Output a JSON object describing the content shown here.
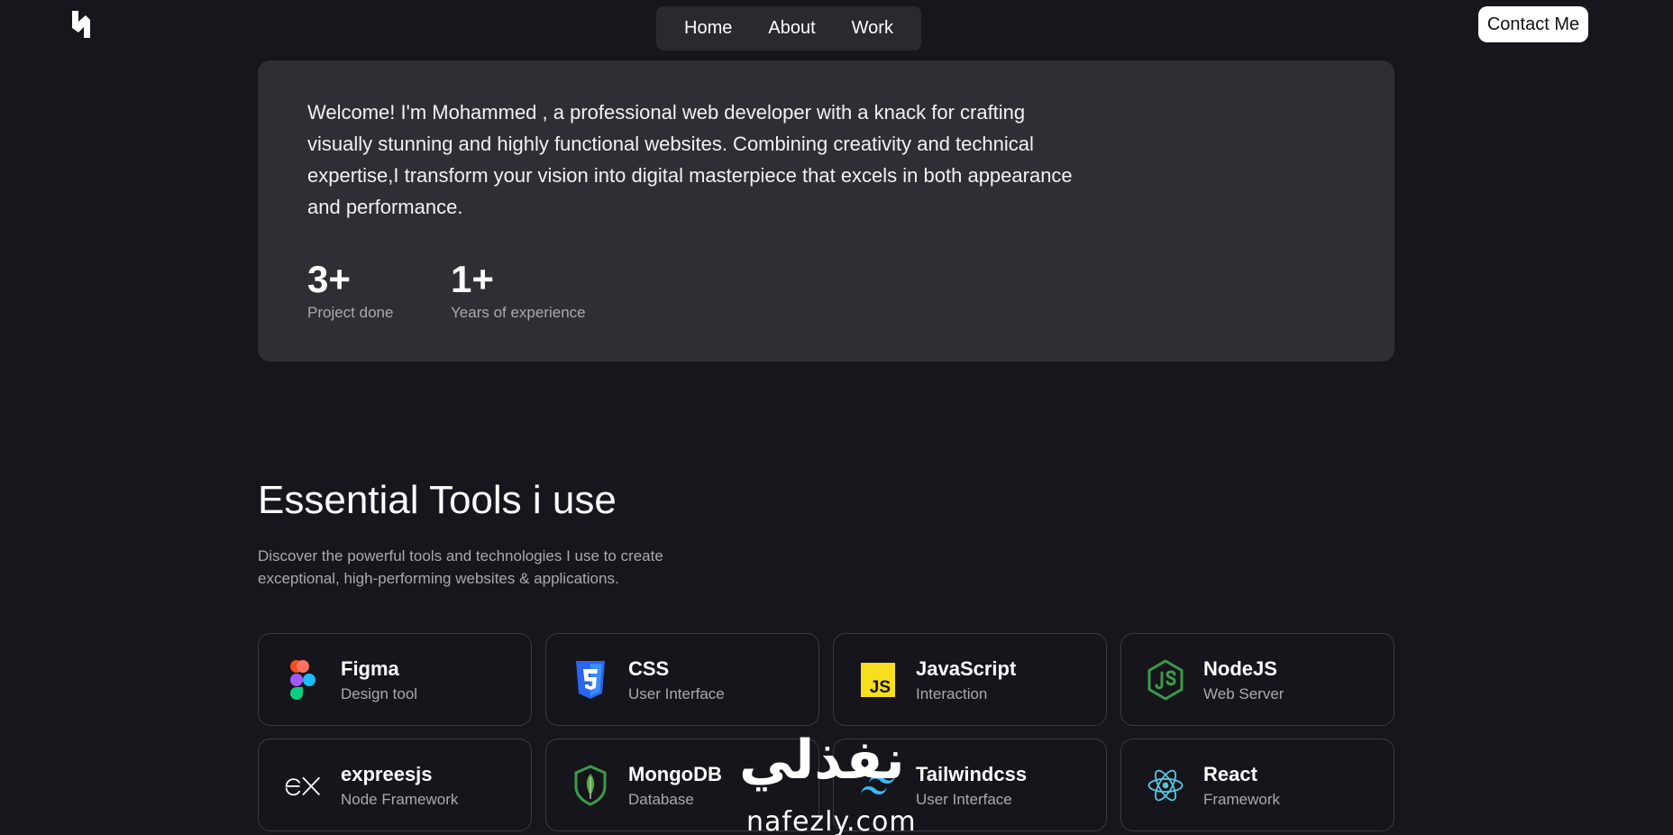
{
  "header": {
    "logo_icon": "brand-logo-icon",
    "nav": [
      {
        "label": "Home"
      },
      {
        "label": "About"
      },
      {
        "label": "Work"
      }
    ],
    "contact_label": "Contact Me"
  },
  "hero": {
    "intro": "Welcome! I'm Mohammed , a professional web developer with a knack for crafting visually stunning and highly functional websites. Combining creativity and technical expertise,I transform your vision into digital masterpiece that excels in both appearance and performance.",
    "stats": [
      {
        "value": "3+",
        "label": "Project done"
      },
      {
        "value": "1+",
        "label": "Years of experience"
      }
    ]
  },
  "tools": {
    "title": "Essential Tools i use",
    "subtitle": "Discover the powerful tools and technologies I use to create exceptional, high-performing websites & applications.",
    "items": [
      {
        "name": "Figma",
        "desc": "Design tool",
        "icon": "figma-icon"
      },
      {
        "name": "CSS",
        "desc": "User Interface",
        "icon": "css-icon"
      },
      {
        "name": "JavaScript",
        "desc": "Interaction",
        "icon": "javascript-icon"
      },
      {
        "name": "NodeJS",
        "desc": "Web Server",
        "icon": "nodejs-icon"
      },
      {
        "name": "expreesjs",
        "desc": "Node Framework",
        "icon": "expressjs-icon"
      },
      {
        "name": "MongoDB",
        "desc": "Database",
        "icon": "mongodb-icon"
      },
      {
        "name": "Tailwindcss",
        "desc": "User Interface",
        "icon": "tailwindcss-icon"
      },
      {
        "name": "React",
        "desc": "Framework",
        "icon": "react-icon"
      }
    ]
  },
  "watermark": {
    "arabic": "نفذلي",
    "latin": "nafezly.com"
  },
  "colors": {
    "background": "#17161d",
    "card": "#2f2e34",
    "muted_text": "#a9a9ae",
    "contact_bg": "#ffffff"
  }
}
